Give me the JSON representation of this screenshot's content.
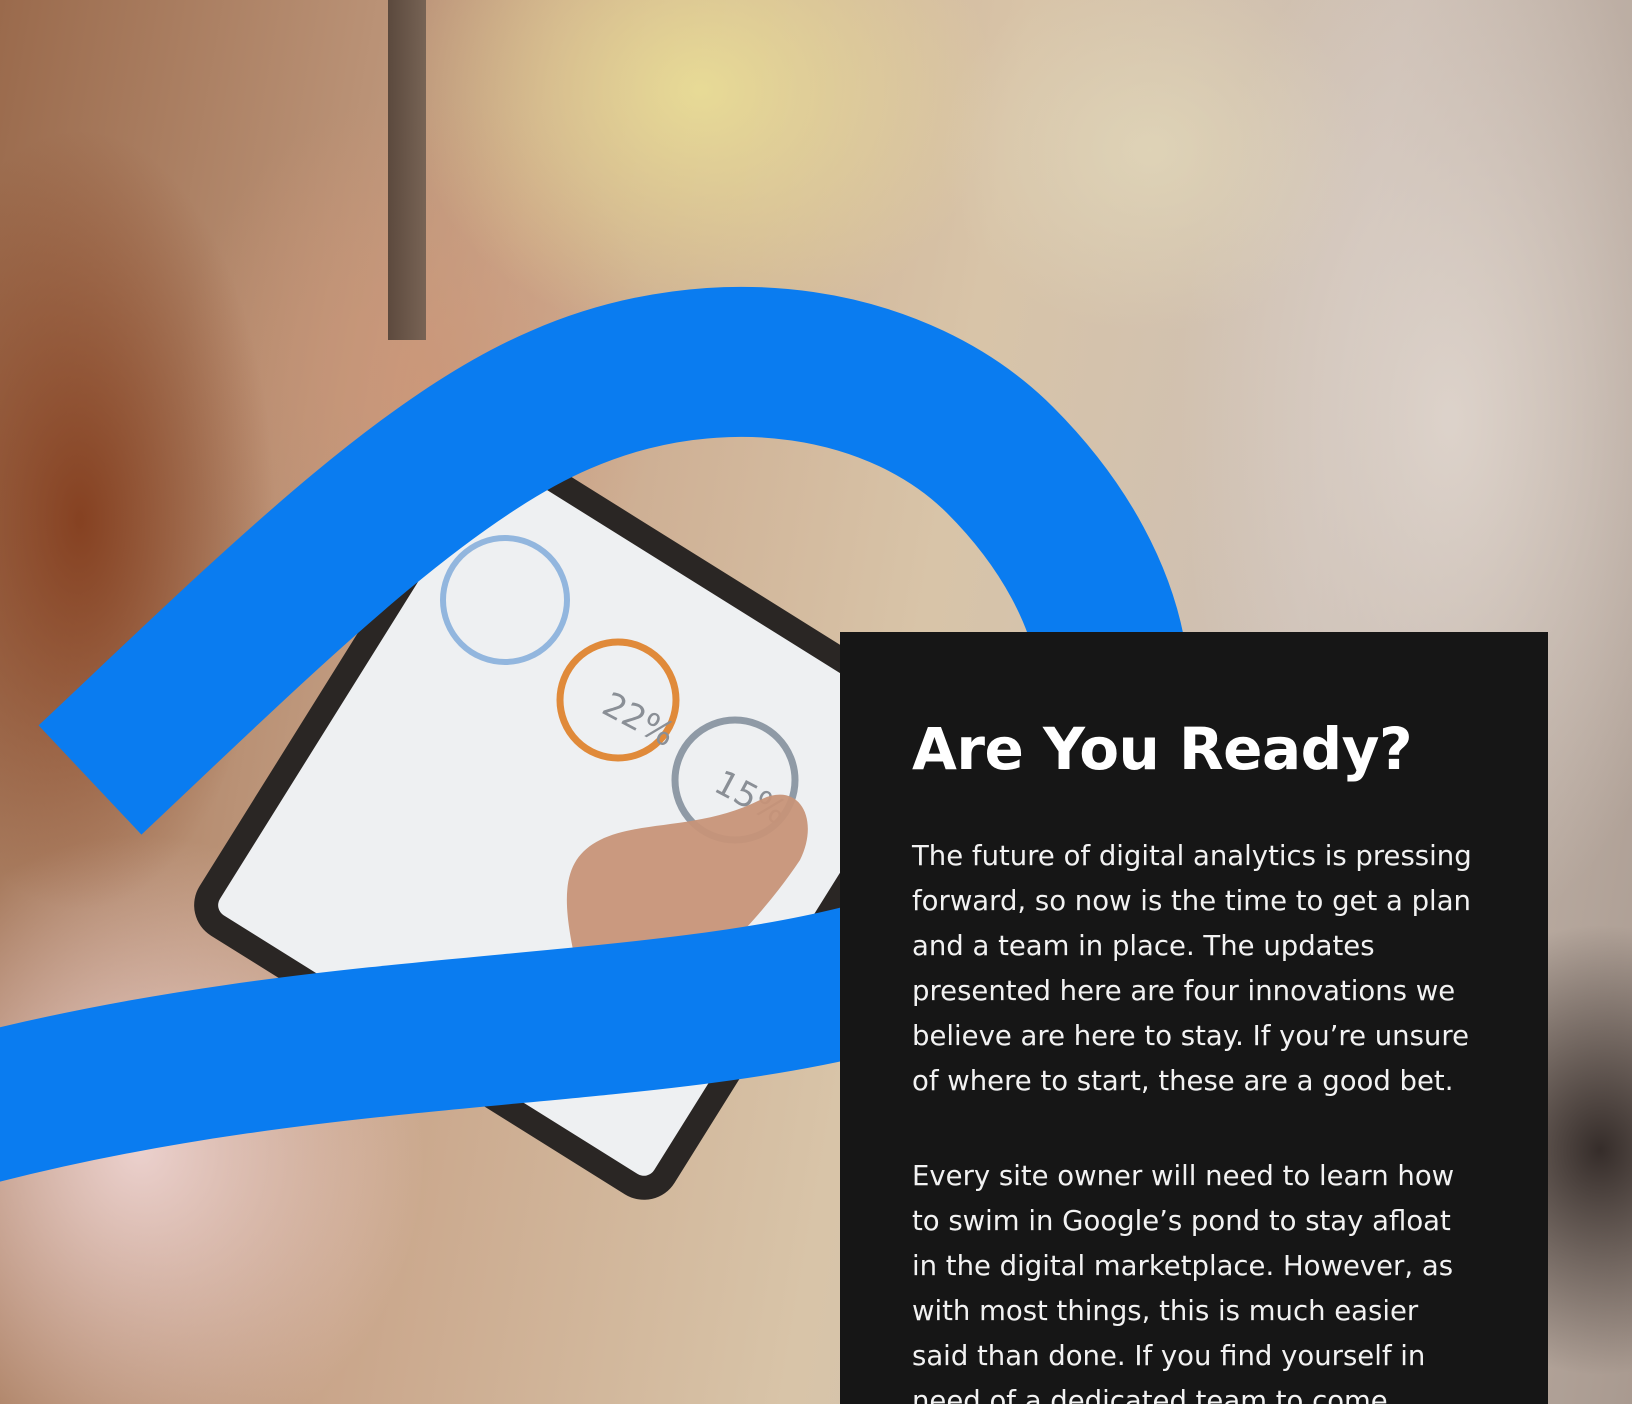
{
  "colors": {
    "accent_blue": "#0a7cf0",
    "panel_background": "#161616",
    "text": "#ffffff"
  },
  "hero_image": {
    "icon": "analytics-tablet-photo",
    "tablet_gauges": [
      "22%",
      "15%"
    ]
  },
  "panel": {
    "title": "Are You Ready?",
    "paragraph_1": "The future of digital analytics is pressing forward, so now is the time to get a plan and a team in place. The updates presented here are four innovations we believe are here to stay. If you’re unsure of where to start, these are a good bet.",
    "paragraph_2": "Every site owner will need to learn how to swim in Google’s pond to stay afloat in the digital marketplace. However, as with most things, this is much easier said than done. If you find yourself in need of a dedicated team to come"
  }
}
